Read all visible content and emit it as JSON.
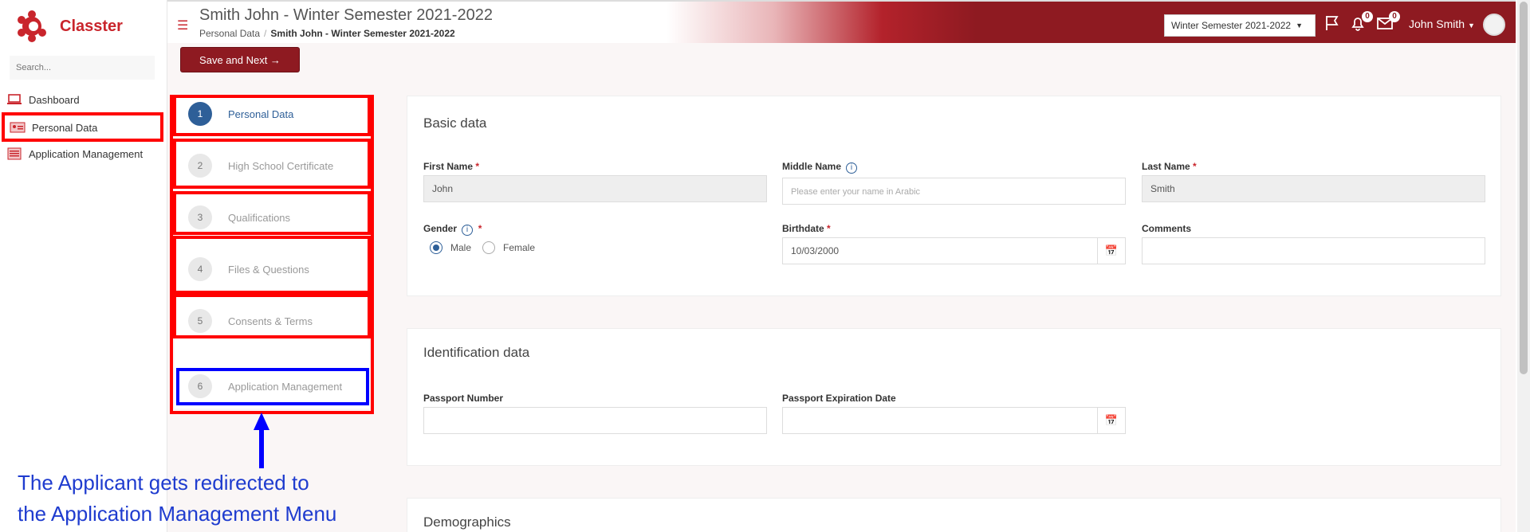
{
  "app": {
    "brand": "Classter"
  },
  "sidebar": {
    "search_placeholder": "Search...",
    "items": [
      {
        "label": "Dashboard",
        "icon": "laptop-icon"
      },
      {
        "label": "Personal Data",
        "icon": "id-card-icon"
      },
      {
        "label": "Application Management",
        "icon": "form-icon"
      }
    ]
  },
  "header": {
    "title": "Smith John - Winter Semester 2021-2022",
    "breadcrumb": [
      "Personal Data",
      "Smith John - Winter Semester 2021-2022"
    ],
    "semester": "Winter Semester 2021-2022",
    "notifications_count": "0",
    "messages_count": "0",
    "user_name": "John Smith"
  },
  "toolbar": {
    "save_next_label": "Save and Next →"
  },
  "steps": [
    {
      "num": "1",
      "label": "Personal Data",
      "active": true
    },
    {
      "num": "2",
      "label": "High School Certificate",
      "active": false
    },
    {
      "num": "3",
      "label": "Qualifications",
      "active": false
    },
    {
      "num": "4",
      "label": "Files & Questions",
      "active": false
    },
    {
      "num": "5",
      "label": "Consents & Terms",
      "active": false
    },
    {
      "num": "6",
      "label": "Application Management",
      "active": false
    }
  ],
  "basic_data": {
    "title": "Basic data",
    "first_name_label": "First Name",
    "first_name_value": "John",
    "middle_name_label": "Middle Name",
    "middle_name_placeholder": "Please enter your name in Arabic",
    "last_name_label": "Last Name",
    "last_name_value": "Smith",
    "gender_label": "Gender",
    "gender_options": [
      "Male",
      "Female"
    ],
    "gender_selected": "Male",
    "birthdate_label": "Birthdate",
    "birthdate_value": "10/03/2000",
    "comments_label": "Comments"
  },
  "identification": {
    "title": "Identification data",
    "passport_number_label": "Passport Number",
    "passport_expiration_label": "Passport Expiration Date"
  },
  "demographics": {
    "title": "Demographics"
  },
  "annotation": {
    "line1": "The Applicant gets redirected to",
    "line2": "the Application Management Menu"
  },
  "colors": {
    "brand_red": "#c9252c",
    "header_dark_red": "#8e1a21",
    "active_blue": "#2e5f98",
    "highlight_red": "#ff0000",
    "highlight_blue": "#0000ff",
    "annotation_blue": "#1f3ccf"
  }
}
